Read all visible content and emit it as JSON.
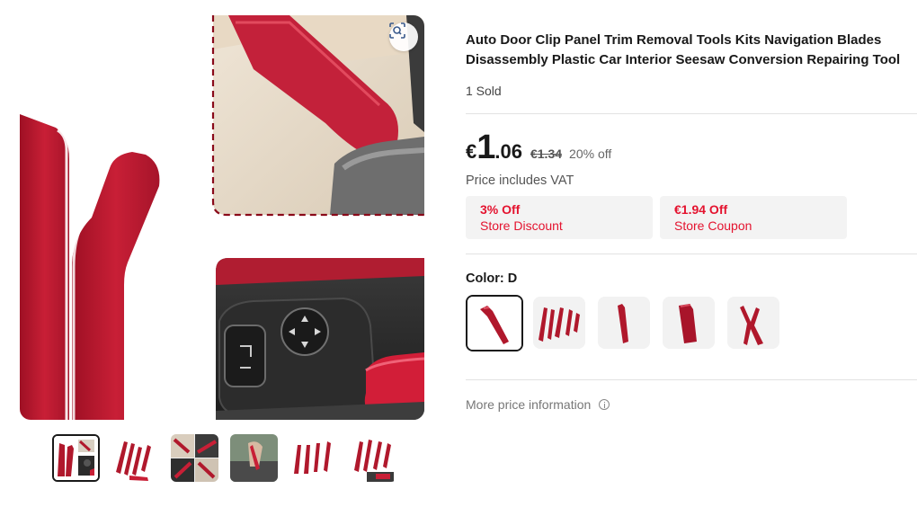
{
  "gallery": {
    "zoom_icon": "scan-zoom-icon",
    "thumbnail_count": 6,
    "selected_thumbnail": 1
  },
  "product": {
    "title": "Auto Door Clip Panel Trim Removal Tools Kits Navigation Blades Disassembly Plastic Car Interior Seesaw Conversion Repairing Tool",
    "sold": "1 Sold"
  },
  "price": {
    "currency": "€",
    "integer": "1",
    "decimal": ".06",
    "original": "€1.34",
    "discount": "20% off",
    "vat_note": "Price includes VAT"
  },
  "promotions": [
    {
      "amount": "3% Off",
      "label": "Store Discount"
    },
    {
      "amount": "€1.94 Off",
      "label": "Store Coupon"
    }
  ],
  "color": {
    "label": "Color: D",
    "option_count": 5,
    "selected_index": 1
  },
  "more_price_info": "More price information",
  "colors": {
    "accent_red": "#e4132f",
    "product_red": "#b0182c",
    "text": "#191919"
  }
}
